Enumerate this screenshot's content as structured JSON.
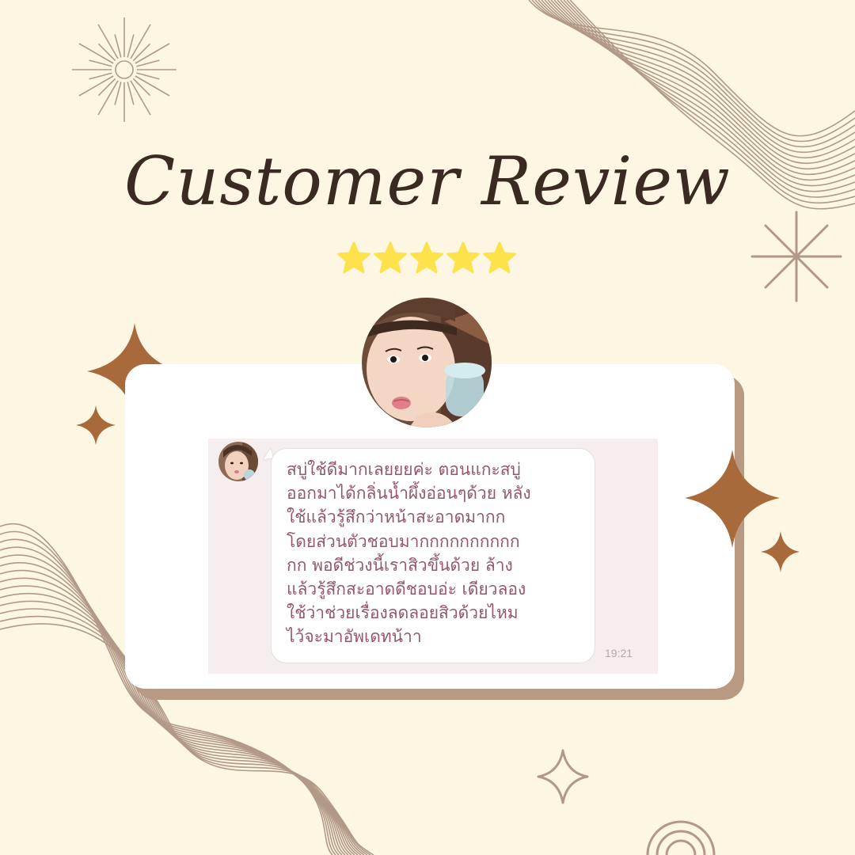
{
  "title": "Customer Review",
  "rating": 5,
  "colors": {
    "background": "#fcf6e3",
    "title": "#3b2a22",
    "star": "#fde24c",
    "sparkle": "#a86a3b",
    "line_art": "#b29987",
    "message_text": "#94566f"
  },
  "review": {
    "message_lines": [
      "สบู่ใช้ดีมากเลยยยค่ะ ตอนแกะสบู่",
      "ออกมาได้กลิ่นน้ำผึ้งอ่อนๆด้วย หลัง",
      "ใช้แล้วรู้สึกว่าหน้าสะอาดมากก",
      "โดยส่วนตัวชอบมากกกกกกกกกก",
      "กก พอดีช่วงนี้เราสิวขึ้นด้วย ล้าง",
      "แล้วรู้สึกสะอาดดีชอบอ่ะ เดียวลอง",
      "ใช้ว่าช่วยเรื่องลดลอยสิวด้วยไหม",
      "ไว้จะมาอัพเดทน้าา"
    ],
    "time": "19:21"
  },
  "icons": [
    "sunburst-icon",
    "asterisk-star-icon",
    "sparkle-icon",
    "star-icon",
    "outline-sparkle-icon",
    "rainbow-arc-icon",
    "avatar-photo"
  ]
}
